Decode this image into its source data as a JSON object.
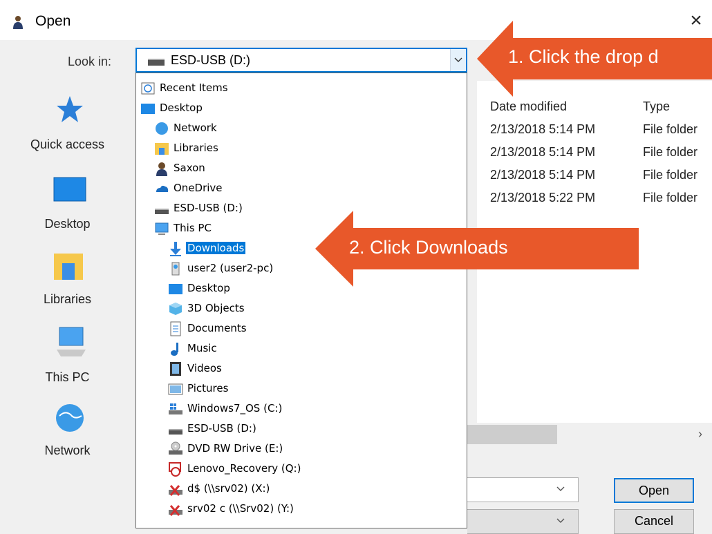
{
  "window": {
    "title": "Open",
    "close_glyph": "×"
  },
  "lookin": {
    "label": "Look in:",
    "value": "ESD-USB (D:)"
  },
  "places": [
    {
      "label": "Quick access",
      "icon": "quick-access-icon"
    },
    {
      "label": "Desktop",
      "icon": "desktop-icon"
    },
    {
      "label": "Libraries",
      "icon": "libraries-icon"
    },
    {
      "label": "This PC",
      "icon": "this-pc-icon"
    },
    {
      "label": "Network",
      "icon": "network-icon"
    }
  ],
  "file_list": {
    "columns": [
      "Date modified",
      "Type"
    ],
    "rows": [
      {
        "date": "2/13/2018 5:14 PM",
        "type": "File folder"
      },
      {
        "date": "2/13/2018 5:14 PM",
        "type": "File folder"
      },
      {
        "date": "2/13/2018 5:14 PM",
        "type": "File folder"
      },
      {
        "date": "2/13/2018 5:22 PM",
        "type": "File folder"
      }
    ]
  },
  "dropdown_items": [
    {
      "label": "Recent Items",
      "icon": "recent-items-icon",
      "level": 0
    },
    {
      "label": "Desktop",
      "icon": "desktop-icon",
      "level": 0
    },
    {
      "label": "Network",
      "icon": "network-icon",
      "level": 1
    },
    {
      "label": "Libraries",
      "icon": "libraries-icon",
      "level": 1
    },
    {
      "label": "Saxon",
      "icon": "user-icon",
      "level": 1
    },
    {
      "label": "OneDrive",
      "icon": "onedrive-icon",
      "level": 1
    },
    {
      "label": "ESD-USB (D:)",
      "icon": "usb-drive-icon",
      "level": 1
    },
    {
      "label": "This PC",
      "icon": "this-pc-icon",
      "level": 1
    },
    {
      "label": "Downloads",
      "icon": "downloads-icon",
      "level": 2,
      "selected": true
    },
    {
      "label": "user2 (user2-pc)",
      "icon": "network-share-icon",
      "level": 2
    },
    {
      "label": "Desktop",
      "icon": "desktop-icon",
      "level": 2
    },
    {
      "label": "3D Objects",
      "icon": "3d-objects-icon",
      "level": 2
    },
    {
      "label": "Documents",
      "icon": "documents-icon",
      "level": 2
    },
    {
      "label": "Music",
      "icon": "music-icon",
      "level": 2
    },
    {
      "label": "Videos",
      "icon": "videos-icon",
      "level": 2
    },
    {
      "label": "Pictures",
      "icon": "pictures-icon",
      "level": 2
    },
    {
      "label": "Windows7_OS (C:)",
      "icon": "windows-drive-icon",
      "level": 2
    },
    {
      "label": "ESD-USB (D:)",
      "icon": "usb-drive-icon",
      "level": 2
    },
    {
      "label": "DVD RW Drive (E:)",
      "icon": "dvd-drive-icon",
      "level": 2
    },
    {
      "label": "Lenovo_Recovery (Q:)",
      "icon": "recovery-drive-icon",
      "level": 2
    },
    {
      "label": "d$ (\\\\srv02) (X:)",
      "icon": "disconnected-drive-icon",
      "level": 2
    },
    {
      "label": "srv02 c (\\\\Srv02) (Y:)",
      "icon": "disconnected-drive-icon",
      "level": 2
    }
  ],
  "buttons": {
    "open": "Open",
    "cancel": "Cancel"
  },
  "scroll_right_glyph": "›",
  "callouts": {
    "step1": "1. Click the drop d",
    "step2": "2. Click Downloads",
    "color": "#e8582a"
  },
  "colors": {
    "accent": "#0078d7",
    "callout": "#e8582a"
  }
}
